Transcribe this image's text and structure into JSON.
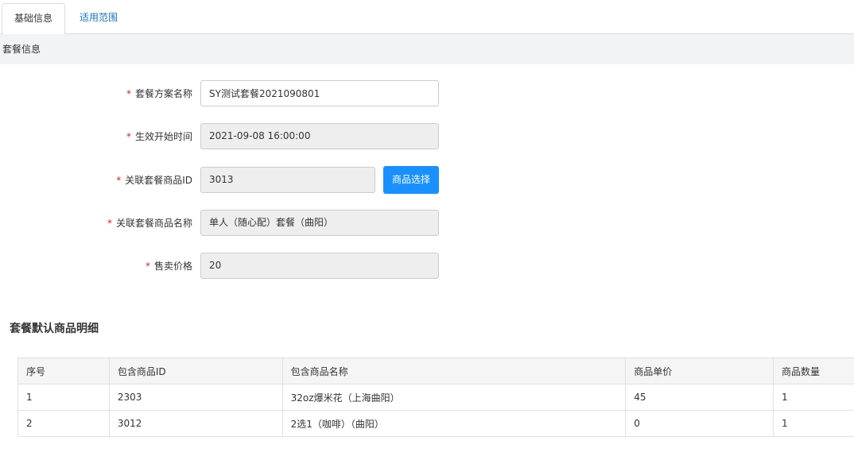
{
  "tabs": [
    {
      "label": "基础信息",
      "active": true
    },
    {
      "label": "适用范围",
      "active": false
    }
  ],
  "section": {
    "title": "套餐信息"
  },
  "form": {
    "plan_name": {
      "label": "套餐方案名称",
      "value": "SY测试套餐2021090801"
    },
    "start_time": {
      "label": "生效开始时间",
      "value": "2021-09-08 16:00:00"
    },
    "product_id": {
      "label": "关联套餐商品ID",
      "value": "3013",
      "button": "商品选择"
    },
    "product_name": {
      "label": "关联套餐商品名称",
      "value": "单人（随心配）套餐（曲阳）"
    },
    "price": {
      "label": "售卖价格",
      "value": "20"
    }
  },
  "detail": {
    "title": "套餐默认商品明细",
    "columns": [
      "序号",
      "包含商品ID",
      "包含商品名称",
      "商品单价",
      "商品数量"
    ],
    "rows": [
      [
        "1",
        "2303",
        "32oz爆米花（上海曲阳）",
        "45",
        "1"
      ],
      [
        "2",
        "3012",
        "2选1（咖啡）（曲阳）",
        "0",
        "1"
      ]
    ]
  },
  "colors": {
    "accent": "#1890ff",
    "required": "#e02020",
    "link": "#1a73c8"
  }
}
